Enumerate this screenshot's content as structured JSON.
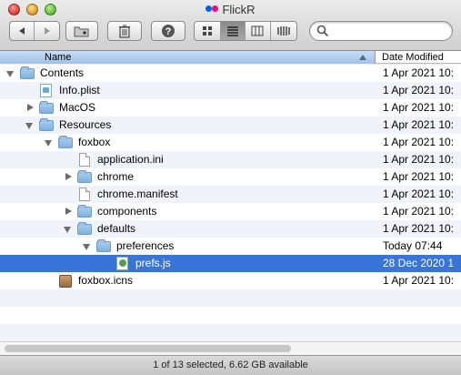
{
  "window": {
    "title": "FlickR",
    "app_icon": "flickr-dots",
    "icon_colors": {
      "blue": "#0063dc",
      "pink": "#ff0084"
    }
  },
  "toolbar": {
    "nav_icons": [
      "back-arrow-icon",
      "forward-arrow-icon"
    ],
    "new_folder_icon": "new-folder-icon",
    "delete_icon": "trash-icon",
    "action_icon": "question-icon",
    "view_modes": [
      "icon-view",
      "list-view",
      "column-view",
      "coverflow-view"
    ],
    "active_view": "list-view",
    "search": {
      "placeholder": "",
      "value": ""
    }
  },
  "columns": {
    "name": "Name",
    "date_modified": "Date Modified",
    "sorted_by": "name"
  },
  "rows": [
    {
      "name": "Contents",
      "date": "1 Apr 2021 10:",
      "kind": "folder",
      "depth": 0,
      "disclosure": "open",
      "selected": false
    },
    {
      "name": "Info.plist",
      "date": "1 Apr 2021 10:",
      "kind": "plist",
      "depth": 1,
      "disclosure": "none",
      "selected": false
    },
    {
      "name": "MacOS",
      "date": "1 Apr 2021 10:",
      "kind": "folder",
      "depth": 1,
      "disclosure": "closed",
      "selected": false
    },
    {
      "name": "Resources",
      "date": "1 Apr 2021 10:",
      "kind": "folder",
      "depth": 1,
      "disclosure": "open",
      "selected": false
    },
    {
      "name": "foxbox",
      "date": "1 Apr 2021 10:",
      "kind": "folder",
      "depth": 2,
      "disclosure": "open",
      "selected": false
    },
    {
      "name": "application.ini",
      "date": "1 Apr 2021 10:",
      "kind": "doc",
      "depth": 3,
      "disclosure": "none",
      "selected": false
    },
    {
      "name": "chrome",
      "date": "1 Apr 2021 10:",
      "kind": "folder",
      "depth": 3,
      "disclosure": "closed",
      "selected": false
    },
    {
      "name": "chrome.manifest",
      "date": "1 Apr 2021 10:",
      "kind": "doc",
      "depth": 3,
      "disclosure": "none",
      "selected": false
    },
    {
      "name": "components",
      "date": "1 Apr 2021 10:",
      "kind": "folder",
      "depth": 3,
      "disclosure": "closed",
      "selected": false
    },
    {
      "name": "defaults",
      "date": "1 Apr 2021 10:",
      "kind": "folder",
      "depth": 3,
      "disclosure": "open",
      "selected": false
    },
    {
      "name": "preferences",
      "date": "Today 07:44",
      "kind": "folder",
      "depth": 4,
      "disclosure": "open",
      "selected": false
    },
    {
      "name": "prefs.js",
      "date": "28 Dec 2020 1",
      "kind": "js",
      "depth": 5,
      "disclosure": "none",
      "selected": true
    },
    {
      "name": "foxbox.icns",
      "date": "1 Apr 2021 10:",
      "kind": "icns",
      "depth": 2,
      "disclosure": "none",
      "selected": false
    }
  ],
  "empty_rows": 3,
  "status": "1 of 13 selected, 6.62 GB available",
  "colors": {
    "selection": "#3875d7",
    "header_sorted": "#9ec0ea",
    "stripe": "#f0f4fa"
  }
}
